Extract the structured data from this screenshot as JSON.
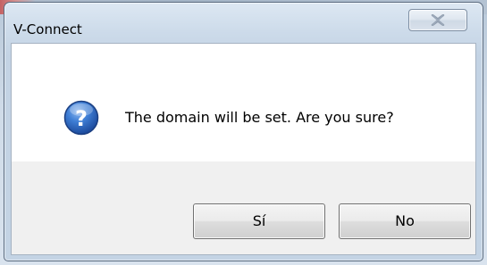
{
  "window": {
    "title": "V-Connect",
    "close_icon": "close-icon"
  },
  "dialog": {
    "icon": "question-icon",
    "message": "The domain will be set. Are you sure?",
    "buttons": {
      "yes_label": "Sí",
      "no_label": "No"
    }
  },
  "colors": {
    "icon_blue": "#2a63b8",
    "client_background": "#f0f0f0",
    "content_background": "#ffffff"
  }
}
